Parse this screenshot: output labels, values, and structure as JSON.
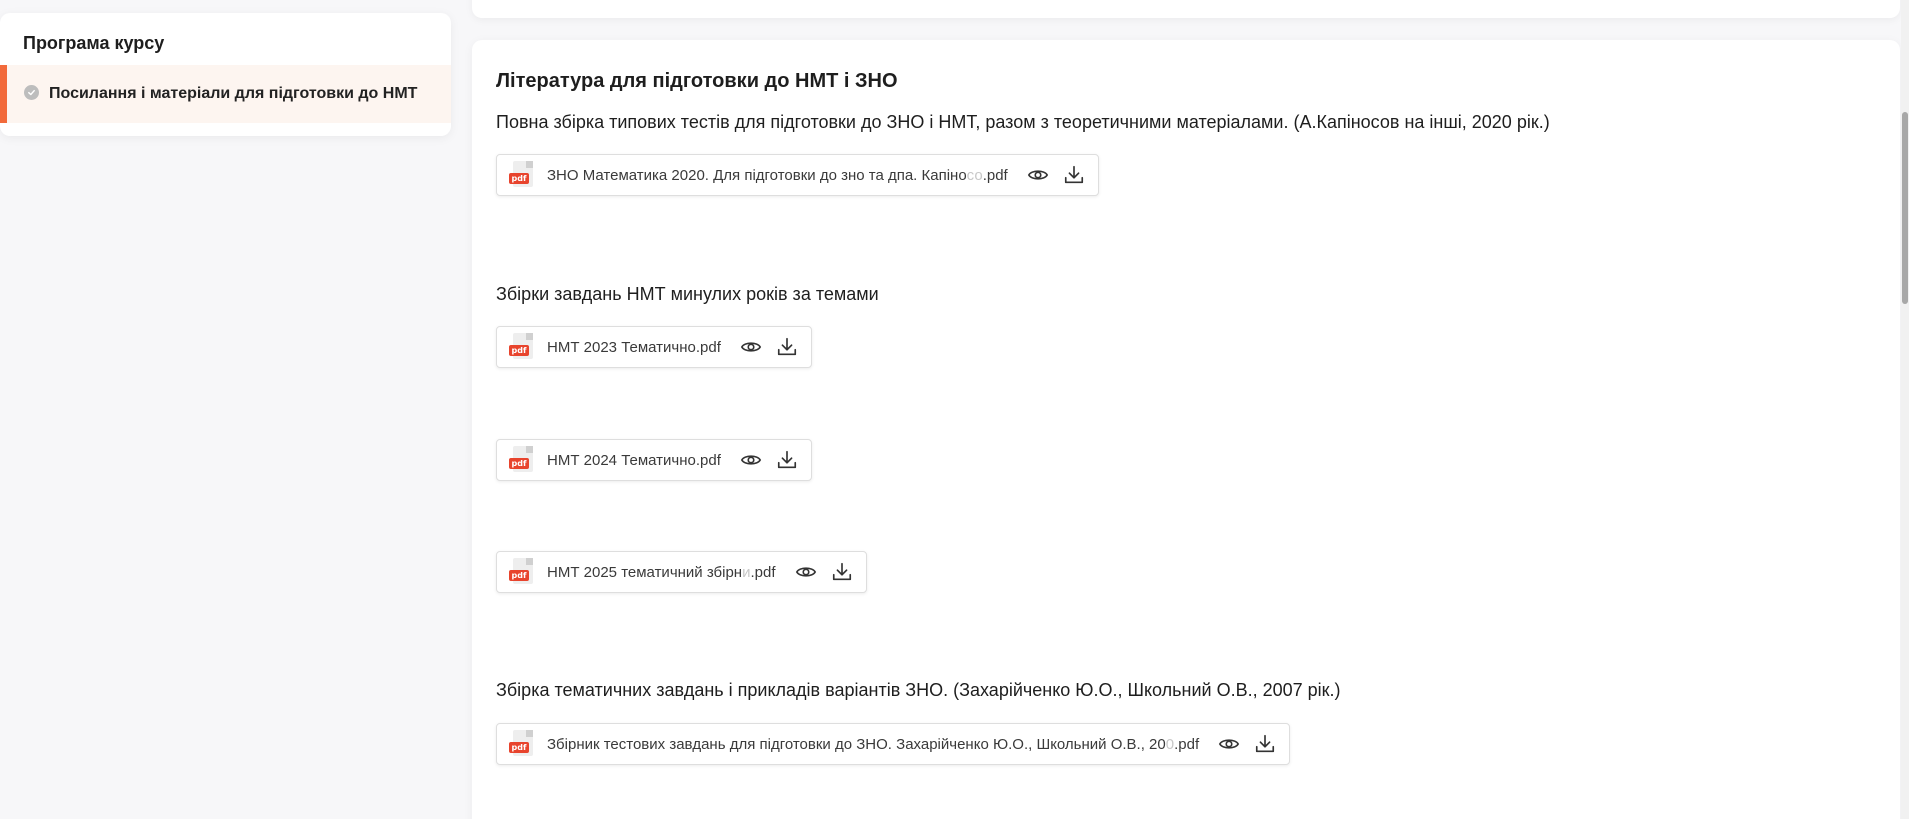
{
  "sidebar": {
    "title": "Програма курсу",
    "items": [
      {
        "label": "Посилання і матеріали для підготовки до НМТ",
        "active": true
      }
    ]
  },
  "main": {
    "heading": "Література для підготовки до НМТ і ЗНО",
    "sections": [
      {
        "text": "Повна збірка типових тестів для підготовки до ЗНО і НМТ, разом з теоретичними матеріалами. (А.Капіносов на інші, 2020 рік.)",
        "files": [
          {
            "name_visible": "ЗНО Математика 2020. Для підготовки до зно та дпа. Капіно",
            "name_faded": "со",
            "ext": ".pdf"
          }
        ]
      },
      {
        "text": "Збірки завдань НМТ минулих років за темами",
        "files": [
          {
            "name_visible": "НМТ 2023 Тематично",
            "name_faded": "",
            "ext": ".pdf"
          },
          {
            "name_visible": "НМТ 2024 Тематично",
            "name_faded": "",
            "ext": ".pdf"
          },
          {
            "name_visible": "НМТ 2025 тематичний збірн",
            "name_faded": "и",
            "ext": ".pdf"
          }
        ]
      },
      {
        "text": "Збірка тематичних завдань і прикладів варіантів ЗНО. (Захарійченко Ю.О., Школьний О.В., 2007 рік.)",
        "files": [
          {
            "name_visible": "Збірник тестових завдань для підготовки до ЗНО. Захарійченко Ю.О., Школьний О.В., 20",
            "name_faded": "0",
            "ext": ".pdf"
          }
        ]
      }
    ]
  },
  "icons": {
    "file": "pdf-file-icon",
    "file_tag": "pdf",
    "view": "eye-icon",
    "download": "download-icon"
  },
  "colors": {
    "accent": "#f26a3b",
    "pdf_red": "#e8442d",
    "active_bg": "#fdf5f0"
  }
}
